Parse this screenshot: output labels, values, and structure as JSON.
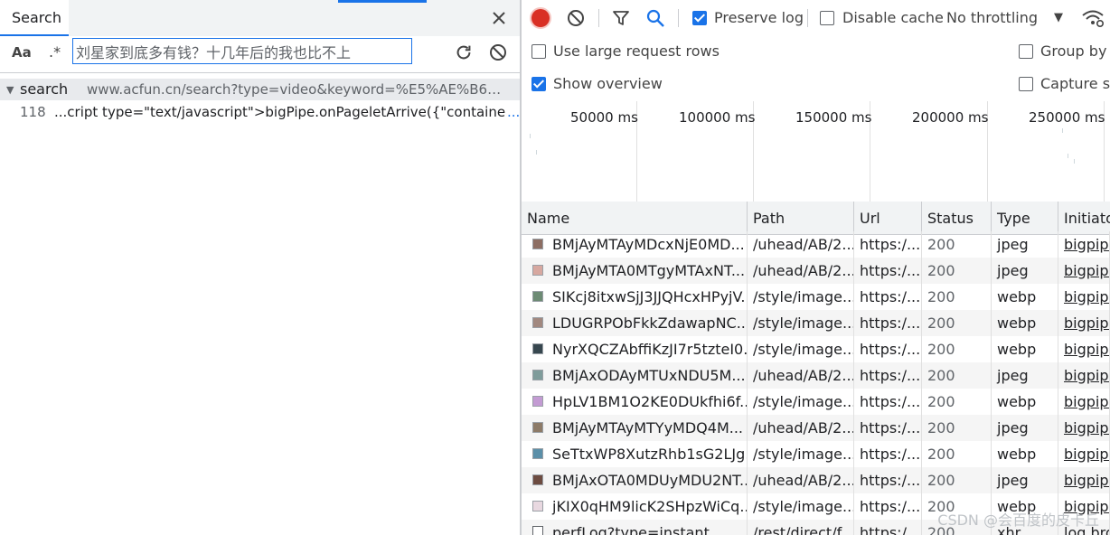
{
  "search_panel": {
    "tab_label": "Search",
    "case_toggle_label": "Aa",
    "regex_toggle_label": ".*",
    "query_value": "刘星家到底多有钱？十几年后的我也比不上",
    "result_file": {
      "name": "search",
      "url": "www.acfun.cn/search?type=video&keyword=%E5%AE%B6%E6..."
    },
    "result_line": {
      "line_number": "118",
      "code": "...cript type=\"text/javascript\">bigPipe.onPageletArrive({\"container\":\"\"",
      "more": "..."
    }
  },
  "network_toolbar": {
    "preserve_log_label": "Preserve log",
    "preserve_log_checked": true,
    "disable_cache_label": "Disable cache",
    "disable_cache_checked": false,
    "throttling_label": "No throttling"
  },
  "network_settings": {
    "large_rows_label": "Use large request rows",
    "large_rows_checked": false,
    "show_overview_label": "Show overview",
    "show_overview_checked": true,
    "group_by_label": "Group by f",
    "capture_label": "Capture sc"
  },
  "overview": {
    "ticks": [
      "50000 ms",
      "100000 ms",
      "150000 ms",
      "200000 ms",
      "250000 ms"
    ]
  },
  "table": {
    "columns": [
      "Name",
      "Path",
      "Url",
      "Status",
      "Type",
      "Initiato"
    ],
    "rows": [
      {
        "name": "BMjAyMTAyMDcxNjE0MD...",
        "path": "/uhead/AB/2...",
        "url": "https:/...",
        "status": "200",
        "type": "jpeg",
        "initiator": "bigpipe",
        "thumb_color": "#8d6e63"
      },
      {
        "name": "BMjAyMTA0MTgyMTAxNT...",
        "path": "/uhead/AB/2...",
        "url": "https:/...",
        "status": "200",
        "type": "jpeg",
        "initiator": "bigpipe",
        "thumb_color": "#d7a8a0"
      },
      {
        "name": "SIKcj8itxwSjJ3JJQHcxHPyjV...",
        "path": "/style/image...",
        "url": "https:/...",
        "status": "200",
        "type": "webp",
        "initiator": "bigpipe",
        "thumb_color": "#6d8b74"
      },
      {
        "name": "LDUGRPObFkkZdawapNC...",
        "path": "/style/image...",
        "url": "https:/...",
        "status": "200",
        "type": "webp",
        "initiator": "bigpipe",
        "thumb_color": "#a1887f"
      },
      {
        "name": "NyrXQCZAbffiKzJI7r5tzteI0...",
        "path": "/style/image...",
        "url": "https:/...",
        "status": "200",
        "type": "webp",
        "initiator": "bigpipe",
        "thumb_color": "#37474f"
      },
      {
        "name": "BMjAxODAyMTUxNDU5M...",
        "path": "/uhead/AB/2...",
        "url": "https:/...",
        "status": "200",
        "type": "jpeg",
        "initiator": "bigpipe",
        "thumb_color": "#7f9c9b"
      },
      {
        "name": "HpLV1BM1O2KE0DUkfhi6f...",
        "path": "/style/image...",
        "url": "https:/...",
        "status": "200",
        "type": "webp",
        "initiator": "bigpipe",
        "thumb_color": "#c39bd3"
      },
      {
        "name": "BMjAyMTAyMTYyMDQ4M...",
        "path": "/uhead/AB/2...",
        "url": "https:/...",
        "status": "200",
        "type": "jpeg",
        "initiator": "bigpipe",
        "thumb_color": "#8d7b68"
      },
      {
        "name": "SeTtxWP8XutzRhb1sG2LJg...",
        "path": "/style/image...",
        "url": "https:/...",
        "status": "200",
        "type": "webp",
        "initiator": "bigpipe",
        "thumb_color": "#5b8fa8"
      },
      {
        "name": "BMjAxOTA0MDUyMDU2NT...",
        "path": "/uhead/AB/2...",
        "url": "https:/...",
        "status": "200",
        "type": "jpeg",
        "initiator": "bigpipe",
        "thumb_color": "#6d4c41"
      },
      {
        "name": "jKIX0qHM9licK2SHpzWiCq...",
        "path": "/style/image...",
        "url": "https:/...",
        "status": "200",
        "type": "webp",
        "initiator": "bigpipe",
        "thumb_color": "#e8d8e0"
      },
      {
        "name": "perfLog?type=instant",
        "path": "/rest/direct/f...",
        "url": "https:/...",
        "status": "200",
        "type": "xhr",
        "initiator": "log.bro",
        "thumb_color": "#ffffff"
      }
    ]
  },
  "watermark": "CSDN @会百度的皮卡丘"
}
